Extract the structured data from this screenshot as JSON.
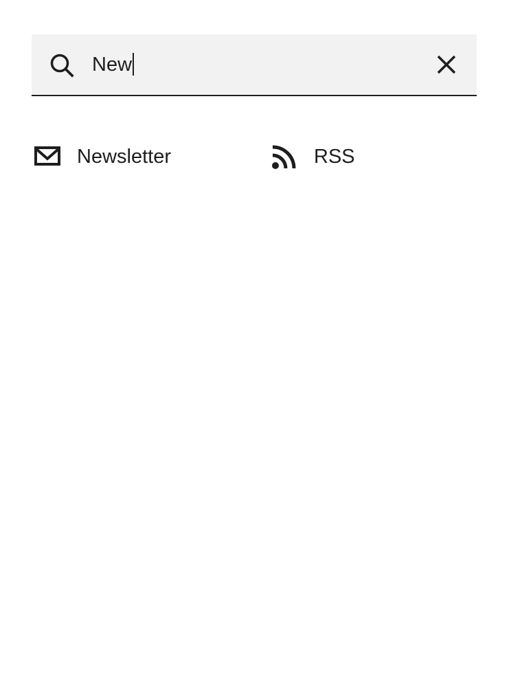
{
  "search": {
    "value": "New",
    "placeholder": "",
    "search_icon": "search-icon",
    "clear_icon": "close-icon"
  },
  "results": [
    {
      "label": "Newsletter",
      "icon": "envelope-icon"
    },
    {
      "label": "RSS",
      "icon": "rss-icon"
    }
  ],
  "colors": {
    "search_background": "#f2f2f2",
    "text": "#1e1e1e",
    "page_background": "#ffffff"
  }
}
